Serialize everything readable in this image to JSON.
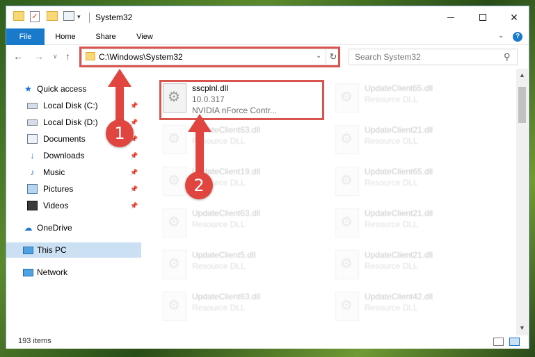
{
  "window": {
    "title": "System32"
  },
  "ribbon": {
    "tabs": [
      "File",
      "Home",
      "Share",
      "View"
    ],
    "help": "?"
  },
  "nav": {
    "address": "C:\\Windows\\System32",
    "search_placeholder": "Search System32"
  },
  "sidebar": {
    "items": [
      {
        "label": "Quick access",
        "icon": "star-icon"
      },
      {
        "label": "Local Disk (C:)",
        "icon": "disk-icon"
      },
      {
        "label": "Local Disk (D:)",
        "icon": "disk-icon"
      },
      {
        "label": "Documents",
        "icon": "documents-icon"
      },
      {
        "label": "Downloads",
        "icon": "download-icon"
      },
      {
        "label": "Music",
        "icon": "music-icon"
      },
      {
        "label": "Pictures",
        "icon": "pictures-icon"
      },
      {
        "label": "Videos",
        "icon": "videos-icon"
      },
      {
        "label": "OneDrive",
        "icon": "cloud-icon"
      },
      {
        "label": "This PC",
        "icon": "computer-icon",
        "selected": true
      },
      {
        "label": "Network",
        "icon": "network-icon"
      }
    ]
  },
  "files": {
    "highlighted": {
      "name": "sscplnl.dll",
      "version": "10.0.317",
      "description": "NVIDIA nForce Contr..."
    },
    "left_column": [
      {
        "name": "UpdateClient63.dll",
        "type": "Resource DLL"
      },
      {
        "name": "UpdateClient19.dll",
        "type": "Resource DLL"
      },
      {
        "name": "UpdateClient63.dll",
        "type": "Resource DLL"
      },
      {
        "name": "UpdateClient5.dll",
        "type": "Resource DLL"
      },
      {
        "name": "UpdateClient63.dll",
        "type": "Resource DLL"
      }
    ],
    "right_column": [
      {
        "name": "UpdateClient65.dll",
        "type": "Resource DLL"
      },
      {
        "name": "UpdateClient21.dll",
        "type": "Resource DLL"
      },
      {
        "name": "UpdateClient65.dll",
        "type": "Resource DLL"
      },
      {
        "name": "UpdateClient21.dll",
        "type": "Resource DLL"
      },
      {
        "name": "UpdateClient21.dll",
        "type": "Resource DLL"
      },
      {
        "name": "UpdateClient42.dll",
        "type": "Resource DLL"
      }
    ]
  },
  "status": {
    "item_count": "193 items"
  },
  "annotations": {
    "step1": "1",
    "step2": "2",
    "color": "#e0453f"
  },
  "colors": {
    "accent": "#1979ca",
    "selection": "#cce0f4",
    "highlight_border": "#d9534f"
  }
}
